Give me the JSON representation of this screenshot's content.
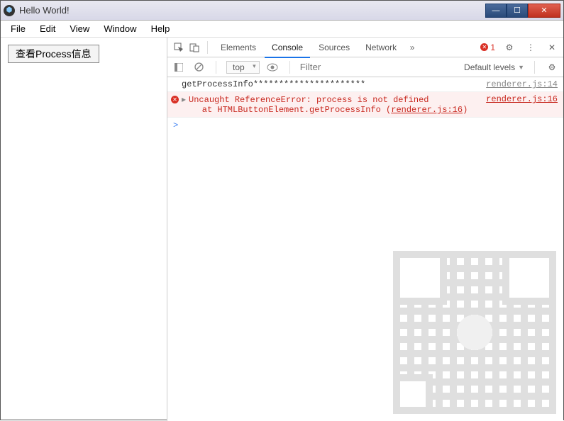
{
  "window": {
    "title": "Hello World!"
  },
  "menu": {
    "file": "File",
    "edit": "Edit",
    "view": "View",
    "window": "Window",
    "help": "Help"
  },
  "app": {
    "button_label": "查看Process信息"
  },
  "devtools": {
    "tabs": {
      "elements": "Elements",
      "console": "Console",
      "sources": "Sources",
      "network": "Network"
    },
    "error_count": "1",
    "toolbar": {
      "context": "top",
      "filter_placeholder": "Filter",
      "levels": "Default levels"
    },
    "logs": [
      {
        "msg": "getProcessInfo**********************",
        "src": "renderer.js:14"
      }
    ],
    "error": {
      "line1": "Uncaught ReferenceError: process is not defined",
      "line2_prefix": "    at HTMLButtonElement.getProcessInfo (",
      "line2_link": "renderer.js:16",
      "line2_suffix": ")",
      "src": "renderer.js:16"
    },
    "prompt": ">"
  }
}
